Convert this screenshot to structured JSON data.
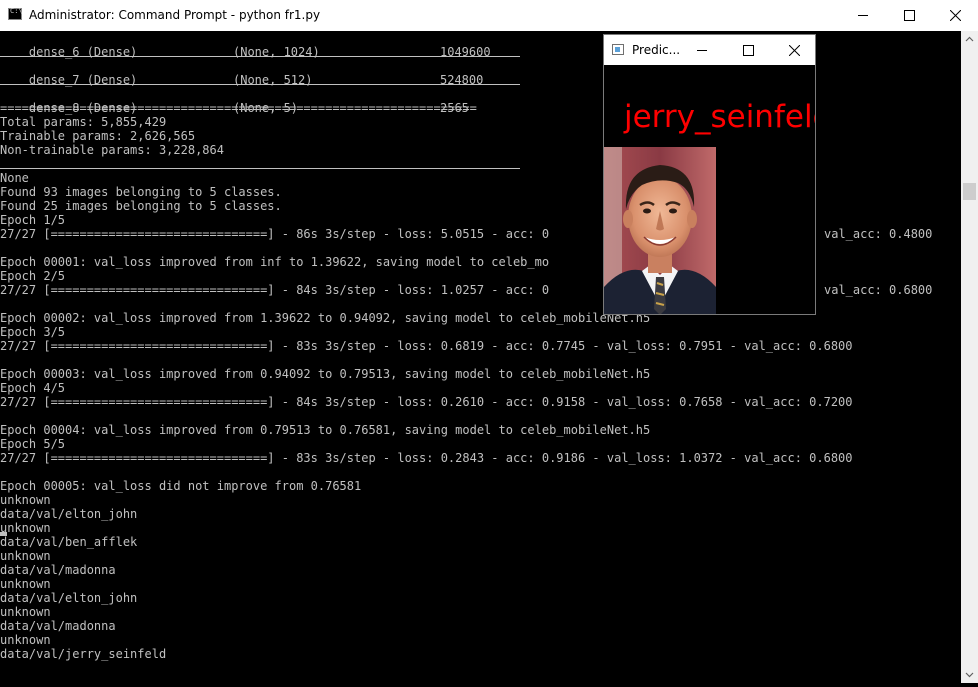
{
  "window": {
    "title": "Administrator: Command Prompt - python  fr1.py"
  },
  "console": {
    "layer_rows": [
      {
        "name": "dense_6 (Dense)",
        "shape": "(None, 1024)",
        "params": "1049600"
      },
      {
        "name": "dense_7 (Dense)",
        "shape": "(None, 512)",
        "params": "524800"
      },
      {
        "name": "dense_8 (Dense)",
        "shape": "(None, 5)",
        "params": "2565"
      }
    ],
    "equals_rule": "==================================================================",
    "total_params": "Total params: 5,855,429",
    "trainable_params": "Trainable params: 2,626,565",
    "non_trainable_params": "Non-trainable params: 3,228,864",
    "none_line": "None",
    "found_train": "Found 93 images belonging to 5 classes.",
    "found_val": "Found 25 images belonging to 5 classes.",
    "epoch1": "Epoch 1/5",
    "progress1": "27/27 [==============================] - 86s 3s/step - loss: 5.0515 - acc: 0",
    "valacc1": "val_acc: 0.4800",
    "improve1": "Epoch 00001: val_loss improved from inf to 1.39622, saving model to celeb_mo",
    "epoch2": "Epoch 2/5",
    "progress2": "27/27 [==============================] - 84s 3s/step - loss: 1.0257 - acc: 0",
    "valacc2": "val_acc: 0.6800",
    "improve2": "Epoch 00002: val_loss improved from 1.39622 to 0.94092, saving model to celeb_mobileNet.h5",
    "epoch3": "Epoch 3/5",
    "progress3": "27/27 [==============================] - 83s 3s/step - loss: 0.6819 - acc: 0.7745 - val_loss: 0.7951 - val_acc: 0.6800",
    "improve3": "Epoch 00003: val_loss improved from 0.94092 to 0.79513, saving model to celeb_mobileNet.h5",
    "epoch4": "Epoch 4/5",
    "progress4": "27/27 [==============================] - 84s 3s/step - loss: 0.2610 - acc: 0.9158 - val_loss: 0.7658 - val_acc: 0.7200",
    "improve4": "Epoch 00004: val_loss improved from 0.79513 to 0.76581, saving model to celeb_mobileNet.h5",
    "epoch5": "Epoch 5/5",
    "progress5": "27/27 [==============================] - 83s 3s/step - loss: 0.2843 - acc: 0.9186 - val_loss: 1.0372 - val_acc: 0.6800",
    "improve5": "Epoch 00005: val_loss did not improve from 0.76581",
    "predictions": [
      "unknown",
      "data/val/elton_john",
      "unknown",
      "data/val/ben_afflek",
      "unknown",
      "data/val/madonna",
      "unknown",
      "data/val/elton_john",
      "unknown",
      "data/val/madonna",
      "unknown",
      "data/val/jerry_seinfeld"
    ]
  },
  "prediction_window": {
    "title": "Predic...",
    "label": "jerry_seinfeld"
  },
  "colors": {
    "console_bg": "#000000",
    "console_text": "#c0c0c0",
    "prediction_label": "#ff0000"
  },
  "icons": {
    "app": "cmd-icon",
    "minimize": "minimize-icon",
    "maximize": "maximize-icon",
    "close": "close-icon"
  }
}
